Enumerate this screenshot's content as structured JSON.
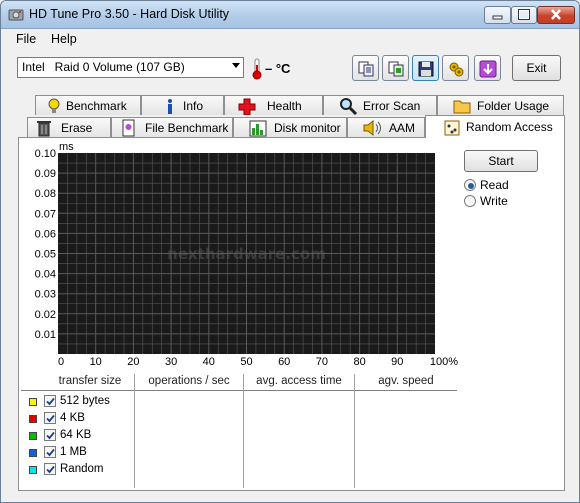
{
  "window": {
    "title": "HD Tune Pro 3.50 - Hard Disk Utility",
    "controls": {
      "minimize": "minimize",
      "maximize": "maximize",
      "close": "close"
    }
  },
  "menu": {
    "file": "File",
    "help": "Help"
  },
  "toolbar": {
    "drive": "Intel   Raid 0 Volume (107 GB)",
    "temperature": "– °C",
    "icons": [
      "copy-info-icon",
      "copy-screen-icon",
      "save-icon",
      "options-icon",
      "download-icon"
    ],
    "exit_label": "Exit"
  },
  "tabs_row1": [
    {
      "label": "Benchmark",
      "icon": "lightbulb-icon"
    },
    {
      "label": "Info",
      "icon": "info-icon"
    },
    {
      "label": "Health",
      "icon": "health-cross-icon"
    },
    {
      "label": "Error Scan",
      "icon": "magnifier-icon"
    },
    {
      "label": "Folder Usage",
      "icon": "folder-icon"
    }
  ],
  "tabs_row2": [
    {
      "label": "Erase",
      "icon": "trash-icon"
    },
    {
      "label": "File Benchmark",
      "icon": "file-benchmark-icon"
    },
    {
      "label": "Disk monitor",
      "icon": "disk-monitor-icon"
    },
    {
      "label": "AAM",
      "icon": "speaker-icon"
    },
    {
      "label": "Random Access",
      "icon": "random-access-icon",
      "active": true
    }
  ],
  "chart": {
    "unit": "ms",
    "watermark": "nexthardware.com",
    "y_ticks": [
      "0.10",
      "0.09",
      "0.08",
      "0.07",
      "0.06",
      "0.05",
      "0.04",
      "0.03",
      "0.02",
      "0.01"
    ],
    "x_ticks": [
      "0",
      "10",
      "20",
      "30",
      "40",
      "50",
      "60",
      "70",
      "80",
      "90",
      "100%"
    ],
    "background": "#1a1a1a",
    "grid_color": "#5a5a5a"
  },
  "chart_data": {
    "type": "scatter",
    "title": "",
    "xlabel": "",
    "ylabel": "ms",
    "xlim": [
      0,
      100
    ],
    "ylim": [
      0,
      0.1
    ],
    "grid": true,
    "series": []
  },
  "controls": {
    "start_label": "Start",
    "read_label": "Read",
    "write_label": "Write",
    "selected": "Read"
  },
  "results": {
    "headers": [
      "transfer size",
      "operations / sec",
      "avg. access time",
      "agv. speed"
    ],
    "rows": [
      {
        "label": "512 bytes",
        "color": "#f5f500",
        "checked": true
      },
      {
        "label": "4 KB",
        "color": "#e00000",
        "checked": true
      },
      {
        "label": "64 KB",
        "color": "#00c000",
        "checked": true
      },
      {
        "label": "1 MB",
        "color": "#1060e0",
        "checked": true
      },
      {
        "label": "Random",
        "color": "#00e8f0",
        "checked": true
      }
    ]
  }
}
